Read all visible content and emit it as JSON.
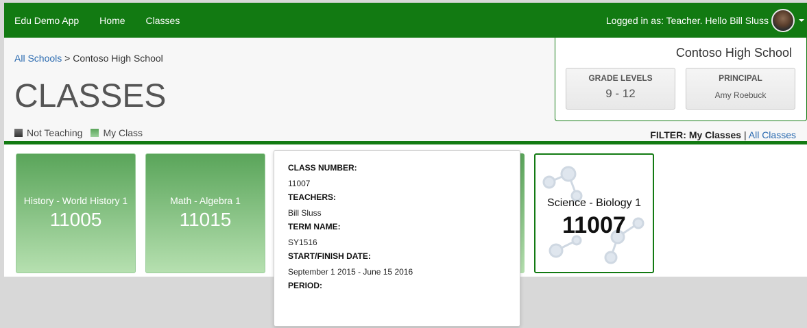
{
  "nav": {
    "brand": "Edu Demo App",
    "links": [
      "Home",
      "Classes"
    ],
    "user_text": "Logged in as: Teacher. Hello Bill Sluss"
  },
  "breadcrumb": {
    "root": "All Schools",
    "separator": ">",
    "current": "Contoso High School"
  },
  "page_title": "CLASSES",
  "legend": {
    "items": [
      {
        "label": "Not Teaching",
        "color": "#555555"
      },
      {
        "label": "My Class",
        "color": "#6ab86a"
      }
    ]
  },
  "school": {
    "name": "Contoso High School",
    "grade_levels_label": "GRADE LEVELS",
    "grade_levels_value": "9 - 12",
    "principal_label": "PRINCIPAL",
    "principal_value": "Amy Roebuck"
  },
  "filter": {
    "label": "FILTER:",
    "active": "My Classes",
    "separator": "|",
    "other": "All Classes"
  },
  "classes": [
    {
      "subject": "History - World History 1",
      "number": "11005"
    },
    {
      "subject": "Math - Algebra 1",
      "number": "11015"
    },
    {
      "subject": "Science - Biology 1",
      "number": "11007"
    }
  ],
  "popover": {
    "fields": [
      {
        "label": "CLASS NUMBER:",
        "value": "11007"
      },
      {
        "label": "TEACHERS:",
        "value": "Bill Sluss"
      },
      {
        "label": "TERM NAME:",
        "value": "SY1516"
      },
      {
        "label": "START/FINISH DATE:",
        "value": "September 1 2015 - June 15 2016"
      },
      {
        "label": "PERIOD:",
        "value": ""
      }
    ]
  },
  "colors": {
    "brand_green": "#127a12",
    "link_blue": "#2a6ab0"
  }
}
